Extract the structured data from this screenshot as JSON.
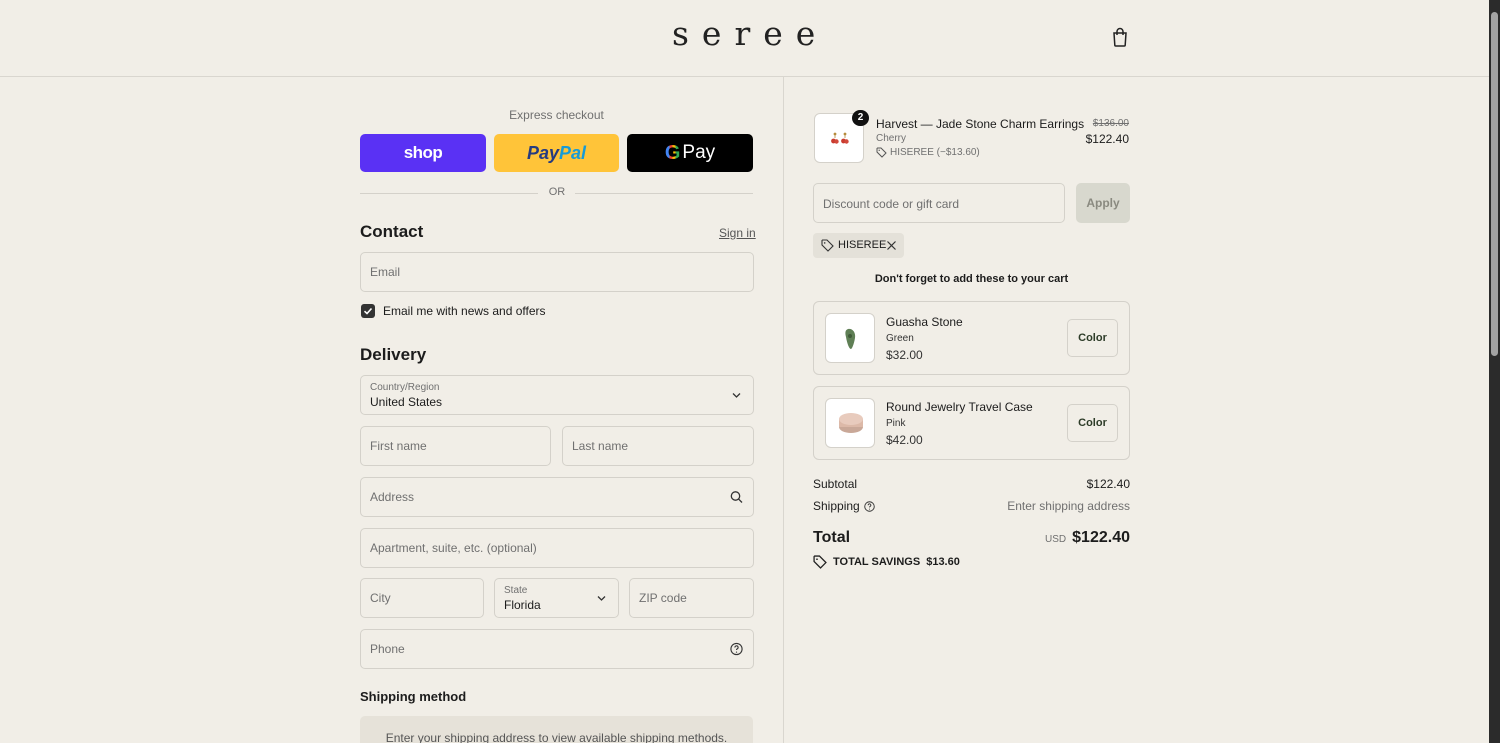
{
  "brand": {
    "logo_text": "seree"
  },
  "express": {
    "label": "Express checkout",
    "shop_label": "shop",
    "paypal_part1": "Pay",
    "paypal_part2": "Pal",
    "gpay_g": "G",
    "gpay_label": "Pay",
    "or_label": "OR"
  },
  "contact": {
    "title": "Contact",
    "signin_label": "Sign in",
    "email_placeholder": "Email",
    "newsletter_label": "Email me with news and offers",
    "newsletter_checked": true
  },
  "delivery": {
    "title": "Delivery",
    "country_label": "Country/Region",
    "country_value": "United States",
    "first_name_placeholder": "First name",
    "last_name_placeholder": "Last name",
    "address_placeholder": "Address",
    "apartment_placeholder": "Apartment, suite, etc. (optional)",
    "city_placeholder": "City",
    "state_label": "State",
    "state_value": "Florida",
    "zip_placeholder": "ZIP code",
    "phone_placeholder": "Phone"
  },
  "shipping_method": {
    "title": "Shipping method",
    "message": "Enter your shipping address to view available shipping methods."
  },
  "cart": {
    "item": {
      "quantity": "2",
      "name": "Harvest — Jade Stone Charm Earrings",
      "variant": "Cherry",
      "discount": "HISEREE (−$13.60)",
      "original_price": "$136.00",
      "price": "$122.40"
    },
    "discount_placeholder": "Discount code or gift card",
    "apply_label": "Apply",
    "applied_code": "HISEREE",
    "upsell_title": "Don't forget to add these to your cart",
    "upsells": [
      {
        "name": "Guasha Stone",
        "variant": "Green",
        "price": "$32.00",
        "button": "Color"
      },
      {
        "name": "Round Jewelry Travel Case",
        "variant": "Pink",
        "price": "$42.00",
        "button": "Color"
      }
    ],
    "subtotal_label": "Subtotal",
    "subtotal_value": "$122.40",
    "shipping_label": "Shipping",
    "shipping_value": "Enter shipping address",
    "total_label": "Total",
    "currency": "USD",
    "total_value": "$122.40",
    "savings_label": "TOTAL SAVINGS",
    "savings_value": "$13.60"
  },
  "colors": {
    "shop": "#5a31f4",
    "paypal": "#ffc439",
    "gpay": "#000000",
    "background": "#f1eee7"
  }
}
